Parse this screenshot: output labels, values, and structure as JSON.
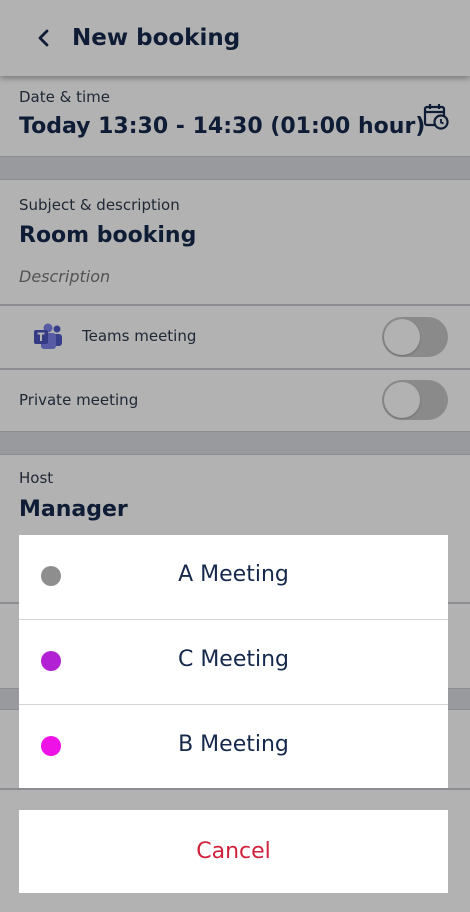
{
  "header": {
    "title": "New booking",
    "back_icon": "chevron-left-icon"
  },
  "datetime": {
    "label": "Date & time",
    "value": "Today 13:30 - 14:30 (01:00 hour)",
    "icon": "calendar-clock-icon"
  },
  "subject": {
    "label": "Subject & description",
    "value": "Room booking",
    "description_placeholder": "Description"
  },
  "teams": {
    "label": "Teams meeting",
    "icon": "microsoft-teams-icon",
    "enabled": false
  },
  "private": {
    "label": "Private meeting",
    "enabled": false
  },
  "host": {
    "label": "Host",
    "value": "Manager"
  },
  "picker": {
    "options": [
      {
        "label": "A Meeting",
        "color": "#8e8e8e"
      },
      {
        "label": "C Meeting",
        "color": "#b222d4"
      },
      {
        "label": "B Meeting",
        "color": "#ee12e6"
      }
    ],
    "cancel_label": "Cancel"
  },
  "colors": {
    "primary_text": "#16294c",
    "cancel": "#d0223d",
    "teams_brand": "#5059c9"
  }
}
